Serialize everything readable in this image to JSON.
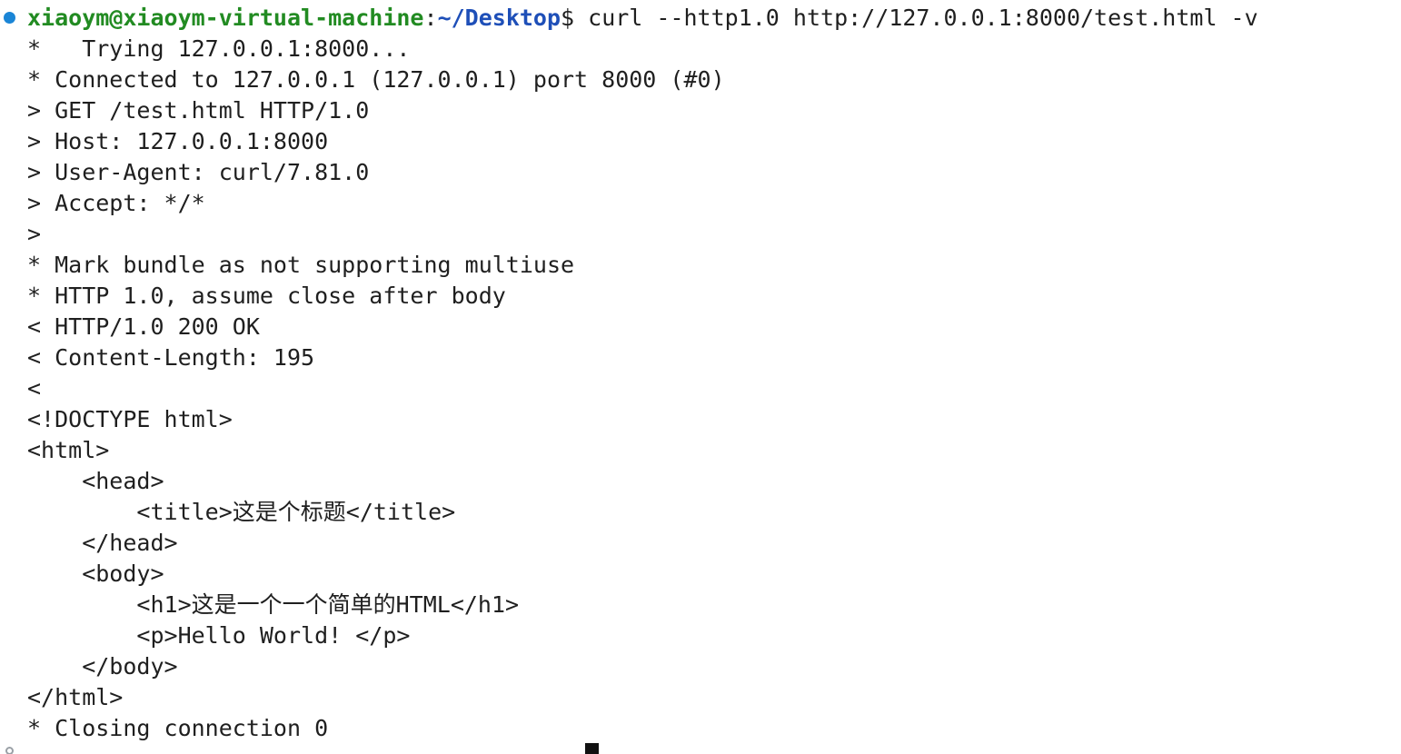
{
  "prompt": {
    "user_host": "xiaoym@xiaoym-virtual-machine",
    "separator": ":",
    "path": "~/Desktop",
    "symbol": "$",
    "command": " curl --http1.0 http://127.0.0.1:8000/test.html -v"
  },
  "output_lines": [
    "*   Trying 127.0.0.1:8000...",
    "* Connected to 127.0.0.1 (127.0.0.1) port 8000 (#0)",
    "> GET /test.html HTTP/1.0",
    "> Host: 127.0.0.1:8000",
    "> User-Agent: curl/7.81.0",
    "> Accept: */*",
    ">",
    "* Mark bundle as not supporting multiuse",
    "* HTTP 1.0, assume close after body",
    "< HTTP/1.0 200 OK",
    "< Content-Length: 195",
    "<",
    "<!DOCTYPE html>",
    "<html>",
    "    <head>",
    "        <title>这是个标题</title>",
    "    </head>",
    "    <body>",
    "        <h1>这是一个一个简单的HTML</h1>",
    "        <p>Hello World! </p>",
    "    </body>",
    "</html>",
    "* Closing connection 0"
  ],
  "colors": {
    "prompt_user": "#228b22",
    "prompt_path": "#1e4fb8",
    "text": "#1f1f1f",
    "status_dot": "#1a85d6"
  },
  "icons": {
    "status": "command-status-dot-icon"
  }
}
